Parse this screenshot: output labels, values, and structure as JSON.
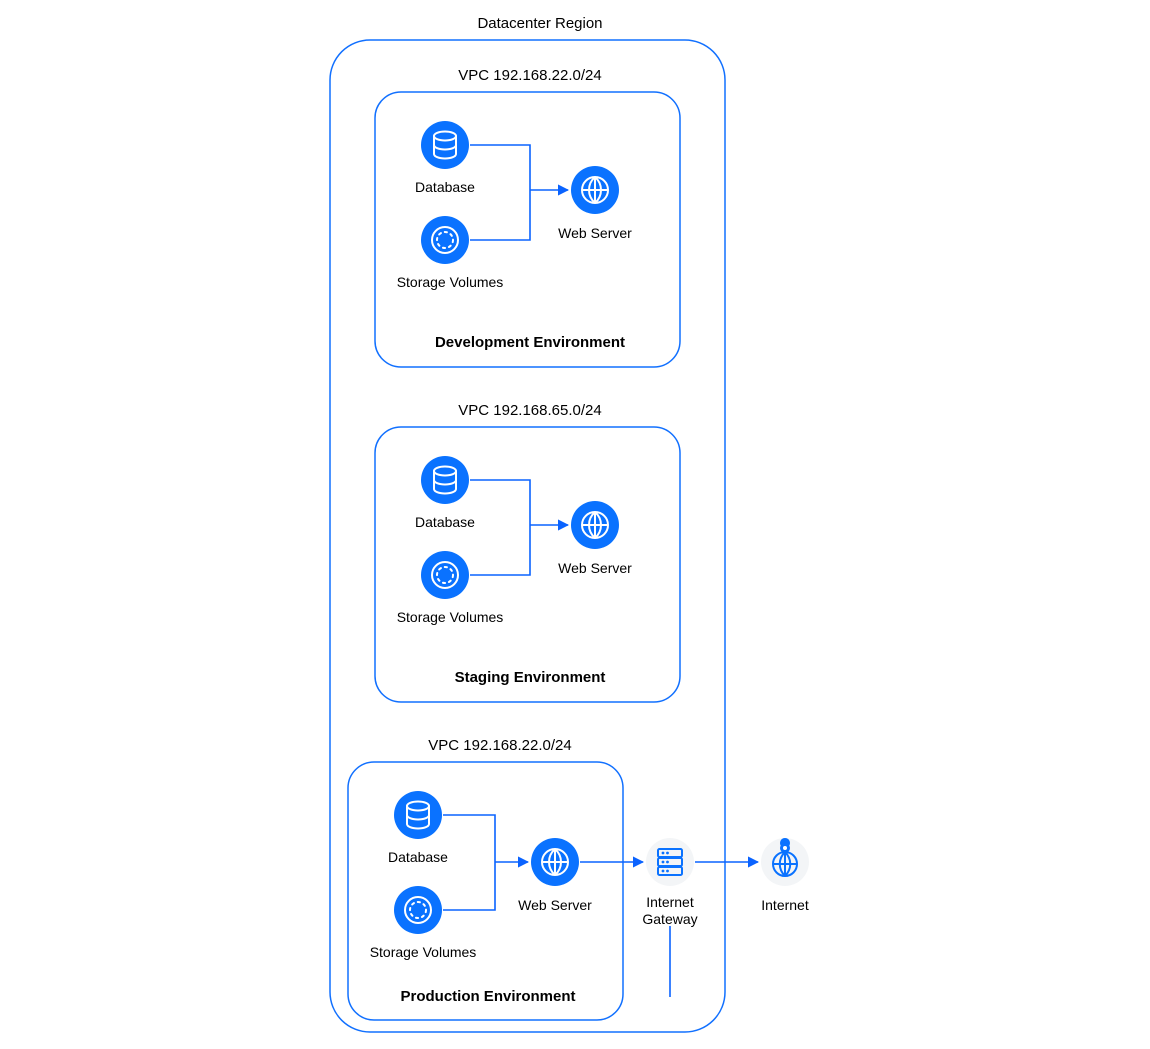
{
  "colors": {
    "accent": "#1170ff",
    "accentFill": "#0a72ff",
    "gatewayBg": "#f3f5f7",
    "gatewayStroke": "#0a72ff",
    "internetStroke": "#0a72ff"
  },
  "region": {
    "title": "Datacenter Region"
  },
  "vpcs": [
    {
      "cidr_label": "VPC 192.168.22.0/24",
      "env_label": "Development Environment",
      "nodes": {
        "database": {
          "label": "Database",
          "icon": "database-icon"
        },
        "storage": {
          "label": "Storage Volumes",
          "icon": "storage-icon"
        },
        "web": {
          "label": "Web Server",
          "icon": "globe-icon"
        }
      }
    },
    {
      "cidr_label": "VPC 192.168.65.0/24",
      "env_label": "Staging Environment",
      "nodes": {
        "database": {
          "label": "Database",
          "icon": "database-icon"
        },
        "storage": {
          "label": "Storage Volumes",
          "icon": "storage-icon"
        },
        "web": {
          "label": "Web Server",
          "icon": "globe-icon"
        }
      }
    },
    {
      "cidr_label": "VPC 192.168.22.0/24",
      "env_label": "Production Environment",
      "nodes": {
        "database": {
          "label": "Database",
          "icon": "database-icon"
        },
        "storage": {
          "label": "Storage Volumes",
          "icon": "storage-icon"
        },
        "web": {
          "label": "Web Server",
          "icon": "globe-icon"
        }
      }
    }
  ],
  "gateway": {
    "label_line1": "Internet",
    "label_line2": "Gateway",
    "icon": "server-stack-icon"
  },
  "internet": {
    "label": "Internet",
    "icon": "internet-icon"
  }
}
